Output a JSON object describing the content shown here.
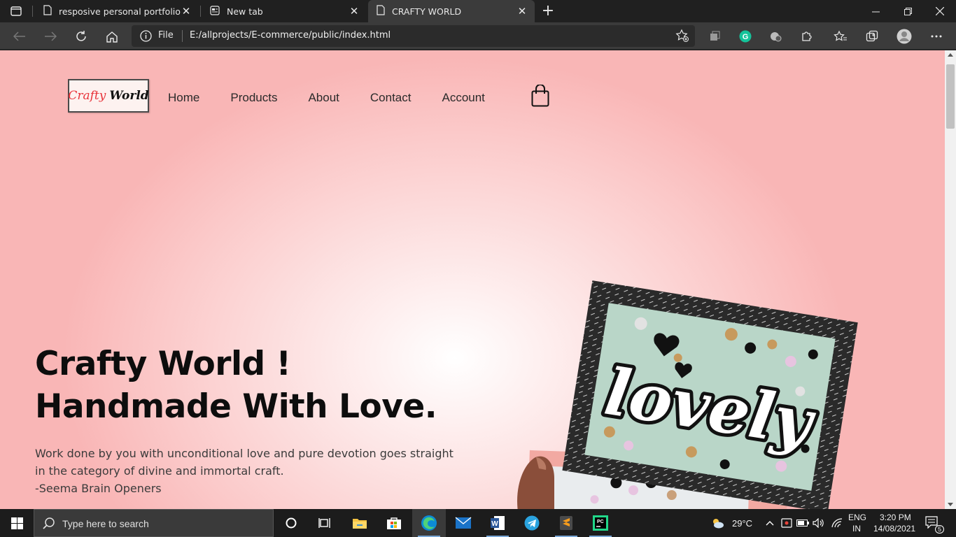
{
  "browser": {
    "tabs": [
      {
        "title": "resposive personal portfolio",
        "icon": "page-icon",
        "active": false
      },
      {
        "title": "New tab",
        "icon": "newtab-icon",
        "active": false
      },
      {
        "title": "CRAFTY WORLD",
        "icon": "page-icon",
        "active": true
      }
    ],
    "address": {
      "scheme_label": "File",
      "url": "E:/allprojects/E-commerce/public/index.html"
    }
  },
  "page": {
    "logo": {
      "word1": "Crafty",
      "word2": "World"
    },
    "nav": [
      {
        "label": "Home"
      },
      {
        "label": "Products"
      },
      {
        "label": "About"
      },
      {
        "label": "Contact"
      },
      {
        "label": "Account"
      }
    ],
    "hero": {
      "heading_line1": "Crafty World !",
      "heading_line2": "Handmade With Love.",
      "quote_line1": "Work done by you with unconditional love and pure devotion goes straight",
      "quote_line2": "in the category of divine and immortal craft.",
      "quote_line3": "-Seema Brain Openers",
      "image_text": "lovely"
    }
  },
  "taskbar": {
    "search_placeholder": "Type here to search",
    "weather": "29°C",
    "language_line1": "ENG",
    "language_line2": "IN",
    "time": "3:20 PM",
    "date": "14/08/2021",
    "notification_count": "5"
  }
}
